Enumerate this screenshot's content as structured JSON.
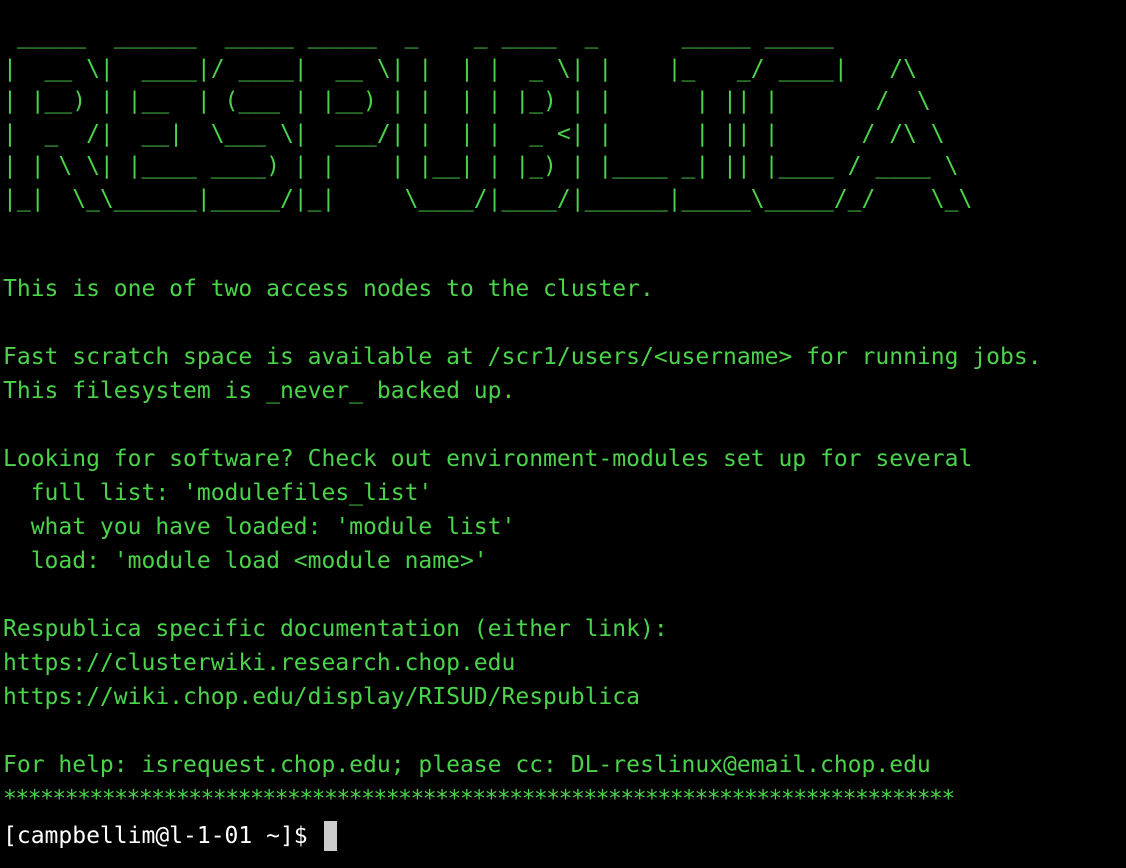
{
  "colors": {
    "background": "#000000",
    "text_green": "#4bd34b",
    "prompt_white": "#ffffff",
    "cursor": "#cccccc"
  },
  "banner": {
    "lines": [
      " _____  ______  _____ _____  _    _ ____  _      _____ _____",
      "|  __ \\|  ____|/ ____|  __ \\| |  | |  _ \\| |    |_   _/ ____|   /\\",
      "| |__) | |__  | (___ | |__) | |  | | |_) | |      | || |       /  \\",
      "|  _  /|  __|  \\___ \\|  ___/| |  | |  _ <| |      | || |      / /\\ \\",
      "| | \\ \\| |____ ____) | |    | |__| | |_) | |____ _| || |____ / ____ \\",
      "|_|  \\_\\______|_____/|_|     \\____/|____/|______|_____\\_____/_/    \\_\\"
    ]
  },
  "motd": {
    "line1": "This is one of two access nodes to the cluster.",
    "line2": "Fast scratch space is available at /scr1/users/<username> for running jobs.",
    "line3": "This filesystem is _never_ backed up.",
    "line4": "Looking for software? Check out environment-modules set up for several",
    "line5": "  full list: 'modulefiles_list'",
    "line6": "  what you have loaded: 'module list'",
    "line7": "  load: 'module load <module name>'",
    "line8": "Respublica specific documentation (either link):",
    "line9": "https://clusterwiki.research.chop.edu",
    "line10": "https://wiki.chop.edu/display/RISUD/Respublica",
    "line11": "For help: isrequest.chop.edu; please cc: DL-reslinux@email.chop.edu",
    "stars": "*****************************************************************************"
  },
  "prompt": {
    "text": "[campbellim@l-1-01 ~]$ "
  }
}
